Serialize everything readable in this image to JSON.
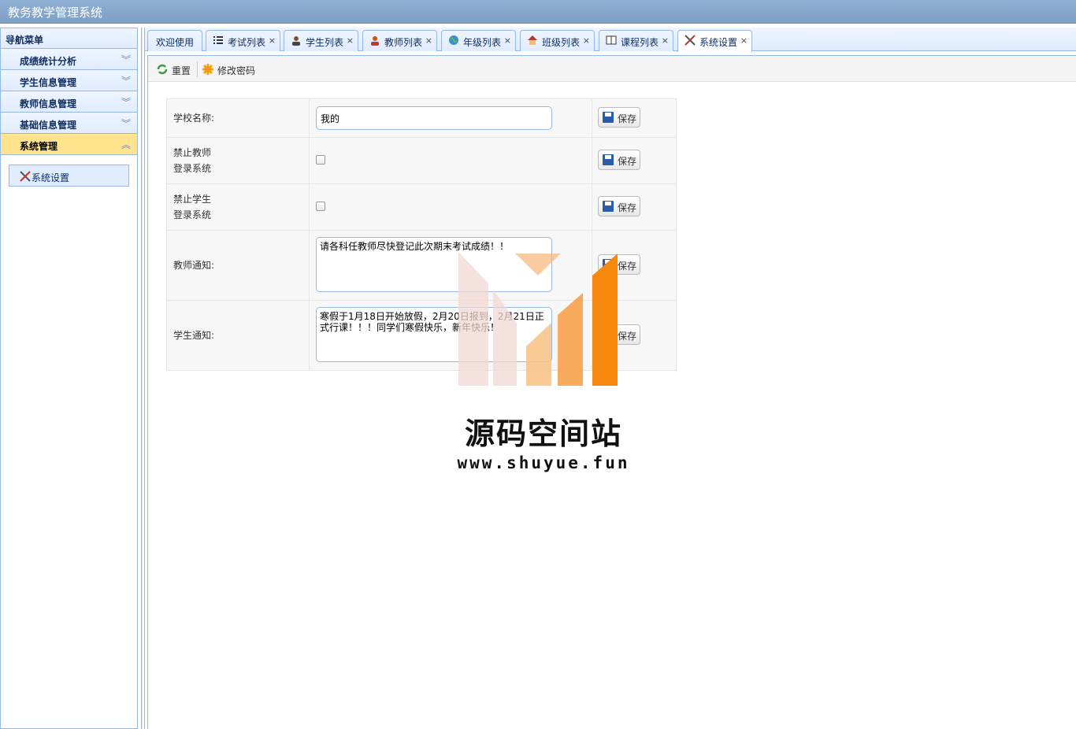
{
  "app": {
    "title": "教务教学管理系统"
  },
  "sidebar": {
    "header": "导航菜单",
    "groups": [
      {
        "label": "成绩统计分析",
        "expanded": false
      },
      {
        "label": "学生信息管理",
        "expanded": false
      },
      {
        "label": "教师信息管理",
        "expanded": false
      },
      {
        "label": "基础信息管理",
        "expanded": false
      },
      {
        "label": "系统管理",
        "expanded": true
      }
    ],
    "sub_item": {
      "label": "系统设置",
      "icon": "tools-icon"
    }
  },
  "tabs": [
    {
      "label": "欢迎使用",
      "icon": null,
      "closable": false
    },
    {
      "label": "考试列表",
      "icon": "list-icon",
      "closable": true
    },
    {
      "label": "学生列表",
      "icon": "user-icon",
      "closable": true
    },
    {
      "label": "教师列表",
      "icon": "user-icon",
      "closable": true
    },
    {
      "label": "年级列表",
      "icon": "globe-icon",
      "closable": true
    },
    {
      "label": "班级列表",
      "icon": "house-icon",
      "closable": true
    },
    {
      "label": "课程列表",
      "icon": "book-icon",
      "closable": true
    },
    {
      "label": "系统设置",
      "icon": "tools-icon",
      "closable": true,
      "selected": true
    }
  ],
  "toolbar": {
    "reset_label": "重置",
    "change_password_label": "修改密码"
  },
  "settings": {
    "school_name": {
      "label": "学校名称:",
      "value": "我的"
    },
    "forbid_teacher": {
      "label_line1": "禁止教师",
      "label_line2": "登录系统",
      "checked": false
    },
    "forbid_student": {
      "label_line1": "禁止学生",
      "label_line2": "登录系统",
      "checked": false
    },
    "teacher_notice": {
      "label": "教师通知:",
      "value": "请各科任教师尽快登记此次期末考试成绩！！"
    },
    "student_notice": {
      "label": "学生通知:",
      "value": "寒假于1月18日开始放假，2月20日报到，2月21日正式行课！！！同学们寒假快乐，新年快乐！"
    },
    "save_label": "保存"
  },
  "watermark": {
    "title": "源码空间站",
    "url": "www.shuyue.fun"
  },
  "colors": {
    "accent_border": "#95b8e7",
    "active_group": "#ffe48d",
    "title_bar": "#7e9fc6"
  }
}
